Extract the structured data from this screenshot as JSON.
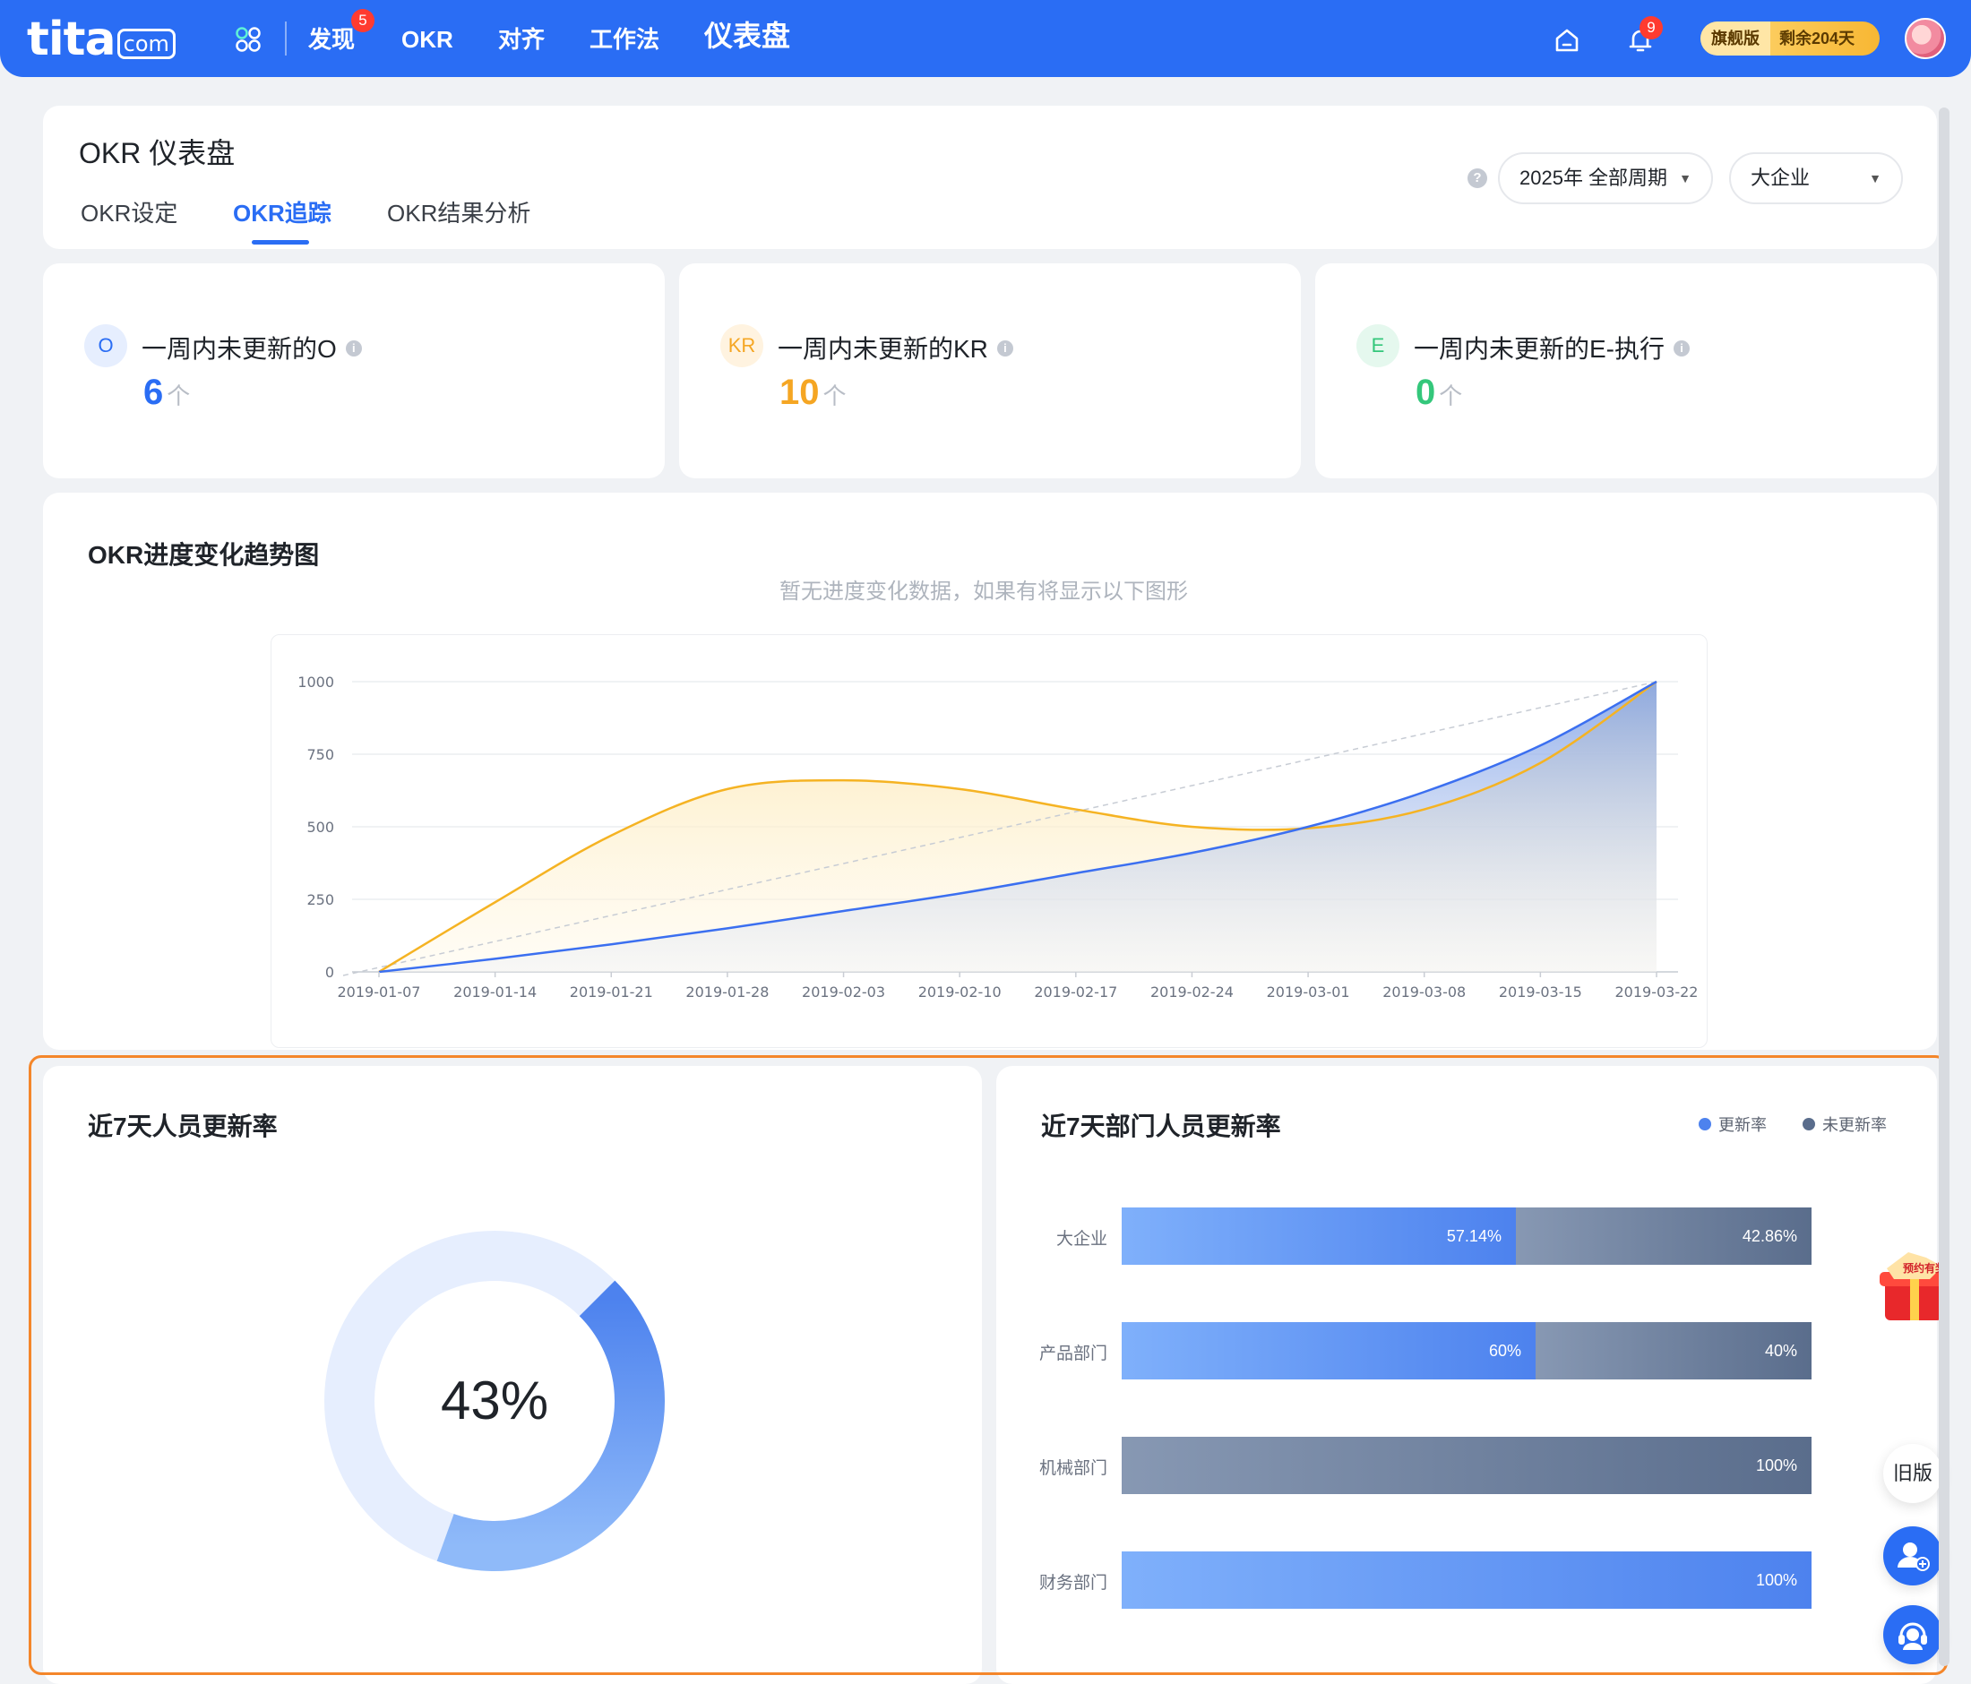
{
  "nav": {
    "logo_main": "tita",
    "logo_suffix": "com",
    "items": [
      {
        "label": "发现",
        "badge": "5"
      },
      {
        "label": "OKR"
      },
      {
        "label": "对齐"
      },
      {
        "label": "工作法"
      },
      {
        "label": "仪表盘"
      }
    ],
    "notification_badge": "9",
    "plan_label": "旗舰版",
    "plan_remaining": "剩余204天",
    "brand_color": "#2a6df4"
  },
  "header": {
    "title": "OKR 仪表盘",
    "tabs": [
      "OKR设定",
      "OKR追踪",
      "OKR结果分析"
    ],
    "active_tab": "OKR追踪",
    "help": "?",
    "period_select": "2025年 全部周期",
    "org_select": "大企业"
  },
  "stats": [
    {
      "icon_text": "O",
      "title": "一周内未更新的O",
      "value": "6",
      "unit": "个",
      "color": "#2a6df4"
    },
    {
      "icon_text": "KR",
      "title": "一周内未更新的KR",
      "value": "10",
      "unit": "个",
      "color": "#f5a623"
    },
    {
      "icon_text": "E",
      "title": "一周内未更新的E-执行",
      "value": "0",
      "unit": "个",
      "color": "#34c77b"
    }
  ],
  "trend": {
    "title": "OKR进度变化趋势图",
    "hint": "暂无进度变化数据，如果有将显示以下图形"
  },
  "chart_data": {
    "type": "area",
    "x": [
      "2019-01-07",
      "2019-01-14",
      "2019-01-21",
      "2019-01-28",
      "2019-02-03",
      "2019-02-10",
      "2019-02-17",
      "2019-02-24",
      "2019-03-01",
      "2019-03-08",
      "2019-03-15",
      "2019-03-22"
    ],
    "ylim": [
      0,
      1000
    ],
    "yticks": [
      "1000",
      "750",
      "500",
      "250",
      "0"
    ],
    "series": [
      {
        "values": [
          0,
          240,
          470,
          630,
          660,
          630,
          560,
          500,
          495,
          560,
          720,
          1000
        ],
        "color": "#f5b323"
      },
      {
        "values": [
          0,
          45,
          95,
          150,
          210,
          270,
          340,
          410,
          500,
          620,
          780,
          1000
        ],
        "color": "#3b6ff0"
      },
      {
        "values": [
          0,
          91,
          182,
          273,
          364,
          455,
          545,
          636,
          727,
          818,
          909,
          1000
        ],
        "color": "#c7ccd4",
        "style": "dashed"
      }
    ],
    "grid": true
  },
  "people_rate": {
    "title": "近7天人员更新率",
    "value": 43,
    "label": "43%"
  },
  "dept_rate": {
    "title": "近7天部门人员更新率",
    "legend_updated": "更新率",
    "legend_not_updated": "未更新率",
    "updated_color": "#4d82ee",
    "not_updated_color": "#5a6d8c",
    "rows": [
      {
        "name": "大企业",
        "updated": 57.14,
        "updated_label": "57.14%",
        "not_label": "42.86%"
      },
      {
        "name": "产品部门",
        "updated": 60,
        "updated_label": "60%",
        "not_label": "40%"
      },
      {
        "name": "机械部门",
        "updated": 0,
        "updated_label": "",
        "not_label": "100%"
      },
      {
        "name": "财务部门",
        "updated": 100,
        "updated_label": "100%",
        "not_label": ""
      }
    ]
  },
  "floating": {
    "old_version": "旧版",
    "gift_text": "预约有奖"
  }
}
